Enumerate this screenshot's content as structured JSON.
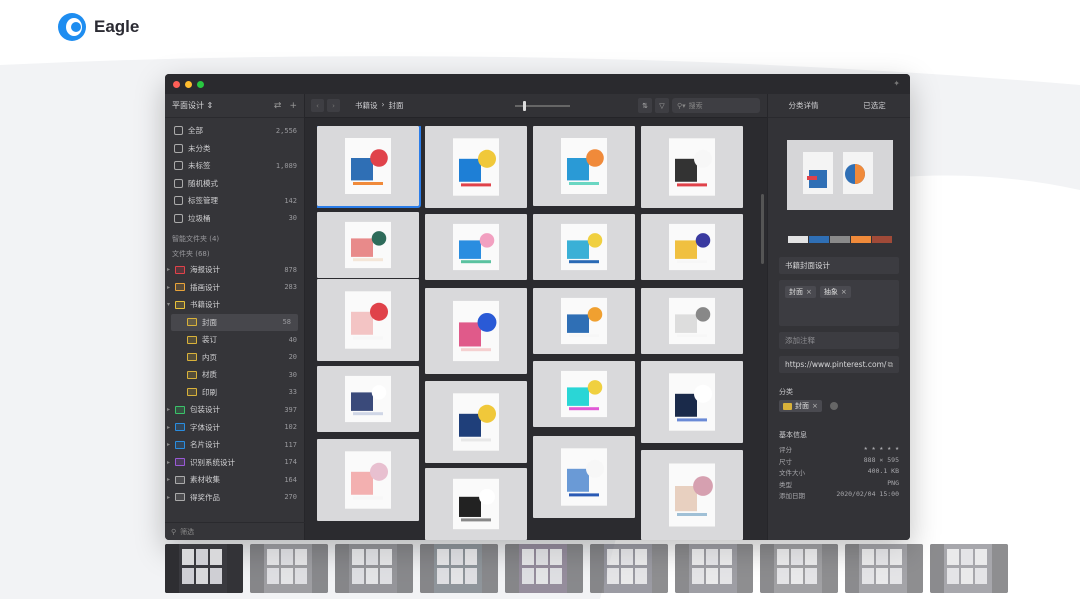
{
  "brand": {
    "name": "Eagle"
  },
  "sidebar": {
    "library": "平面设计 ⇕",
    "items": [
      {
        "label": "全部",
        "count": "2,556",
        "icon": "all-icon"
      },
      {
        "label": "未分类",
        "count": "",
        "icon": "unclassified-icon"
      },
      {
        "label": "未标签",
        "count": "1,089",
        "icon": "untagged-icon"
      },
      {
        "label": "随机模式",
        "count": "",
        "icon": "random-icon"
      },
      {
        "label": "标签管理",
        "count": "142",
        "icon": "tag-icon"
      },
      {
        "label": "垃圾桶",
        "count": "30",
        "icon": "trash-icon"
      }
    ],
    "smart_folders": "智能文件夹 (4)",
    "folders_header": "文件夹 (68)",
    "folders": [
      {
        "label": "海报设计",
        "count": "878",
        "color": "#e0424a",
        "child": false,
        "expanded": false
      },
      {
        "label": "插画设计",
        "count": "283",
        "color": "#e8a33a",
        "child": false,
        "expanded": false
      },
      {
        "label": "书籍设计",
        "count": "",
        "color": "#e8c23a",
        "child": false,
        "expanded": true
      },
      {
        "label": "封面",
        "count": "58",
        "color": "#d9b23a",
        "child": true,
        "active": true
      },
      {
        "label": "装订",
        "count": "40",
        "color": "#d9b23a",
        "child": true
      },
      {
        "label": "内页",
        "count": "20",
        "color": "#d9b23a",
        "child": true
      },
      {
        "label": "材质",
        "count": "30",
        "color": "#d9b23a",
        "child": true
      },
      {
        "label": "印刷",
        "count": "33",
        "color": "#d9b23a",
        "child": true
      },
      {
        "label": "包装设计",
        "count": "397",
        "color": "#3ac26a",
        "child": false
      },
      {
        "label": "字体设计",
        "count": "102",
        "color": "#2a8de0",
        "child": false
      },
      {
        "label": "名片设计",
        "count": "117",
        "color": "#2a8de0",
        "child": false
      },
      {
        "label": "识别系统设计",
        "count": "174",
        "color": "#9a5ad6",
        "child": false
      },
      {
        "label": "素材收集",
        "count": "164",
        "color": "#aaaaaa",
        "child": false
      },
      {
        "label": "得奖作品",
        "count": "270",
        "color": "#aaaaaa",
        "child": false
      }
    ],
    "filter_placeholder": "筛选"
  },
  "toolbar": {
    "breadcrumb_parent": "书籍设",
    "breadcrumb_sep": "›",
    "breadcrumb_current": "封面",
    "search_placeholder": "搜索"
  },
  "inspector": {
    "tab_details": "分类详情",
    "tab_selected": "已选定",
    "palette": [
      "#e3e3e3",
      "#2f6fb5",
      "#8a8a8a",
      "#f08a3a",
      "#a04a38"
    ],
    "title": "书籍封面设计",
    "tags": [
      "封面",
      "抽象"
    ],
    "note_placeholder": "添加注释",
    "url": "https://www.pinterest.com/",
    "category_label": "分类",
    "category_value": "封面",
    "basic_info_label": "基本信息",
    "info": [
      {
        "k": "评分",
        "v": "★ ★ ★ ★ ★"
      },
      {
        "k": "尺寸",
        "v": "888 × 595"
      },
      {
        "k": "文件大小",
        "v": "400.1 KB"
      },
      {
        "k": "类型",
        "v": "PNG"
      },
      {
        "k": "添加日期",
        "v": "2020/02/04 15:00"
      }
    ]
  }
}
